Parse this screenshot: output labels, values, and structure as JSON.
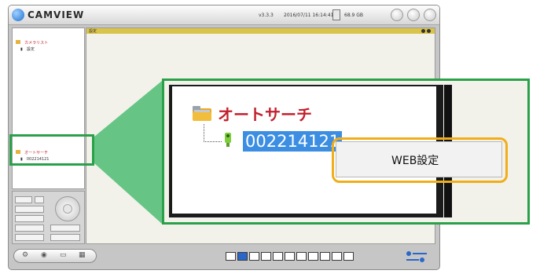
{
  "titlebar": {
    "app_title": "CAMVIEW",
    "version": "v3.3.3",
    "datetime": "2016/07/11 16:14:41",
    "disk": "68.9 GB",
    "buttons": [
      "minimize",
      "maximize",
      "close"
    ]
  },
  "left_panel": {
    "tree": [
      {
        "label": "カメラリスト",
        "icon": "folder-icon"
      },
      {
        "label": "設定",
        "icon": "camera-icon"
      }
    ],
    "tree_zoomed_small": [
      {
        "label": "オートサーチ",
        "icon": "folder-icon"
      },
      {
        "label": "002214121",
        "icon": "camera-icon"
      }
    ]
  },
  "main_view": {
    "title_label": "設定"
  },
  "zoom": {
    "group_label": "オートサーチ",
    "device_id": "002214121",
    "context_menu": [
      {
        "label": "WEB設定"
      }
    ]
  },
  "bottom_bar": {
    "layout_buttons": [
      "layout-1",
      "layout-4",
      "layout-6",
      "layout-8",
      "layout-9",
      "layout-13",
      "layout-16",
      "layout-custom-1",
      "layout-custom-2",
      "layout-custom-3",
      "layout-fullscreen"
    ],
    "active_layout": "layout-4"
  },
  "colors": {
    "callout_green": "#2aa049",
    "highlight_orange": "#f0ae1a",
    "folder_label_red": "#c2202d",
    "selection_blue": "#3c8ee3",
    "view_titlebar": "#dac34a"
  }
}
